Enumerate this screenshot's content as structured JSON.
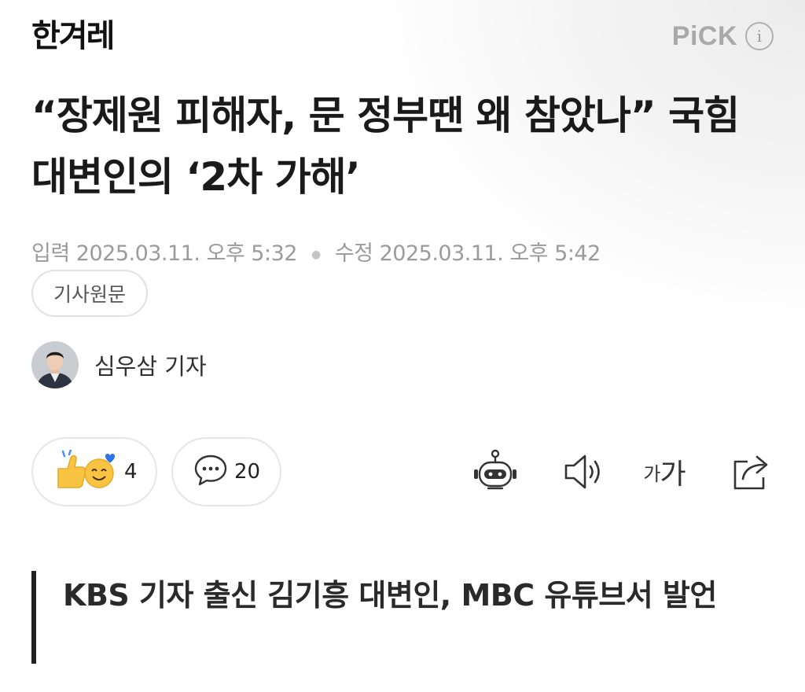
{
  "header": {
    "logo": "한겨레",
    "pick_label": "PiCK",
    "info_icon": "i"
  },
  "article": {
    "headline": "“장제원 피해자, 문 정부땐 왜 참았나” 국힘 대변인의 ‘2차 가해’",
    "published_label": "입력",
    "published": "2025.03.11. 오후 5:32",
    "modified_label": "수정",
    "modified": "2025.03.11. 오후 5:42",
    "original_button": "기사원문",
    "reporter": "심우삼 기자",
    "subheadline": "KBS 기자 출신 김기흥 대변인, MBC 유튜브서 발언"
  },
  "toolbar": {
    "reaction_count": "4",
    "comment_count": "20",
    "font_small": "가",
    "font_large": "가",
    "icons": [
      "reaction-icon",
      "comment-icon",
      "robot-summary-icon",
      "speaker-icon",
      "font-size-icon",
      "share-icon"
    ]
  }
}
